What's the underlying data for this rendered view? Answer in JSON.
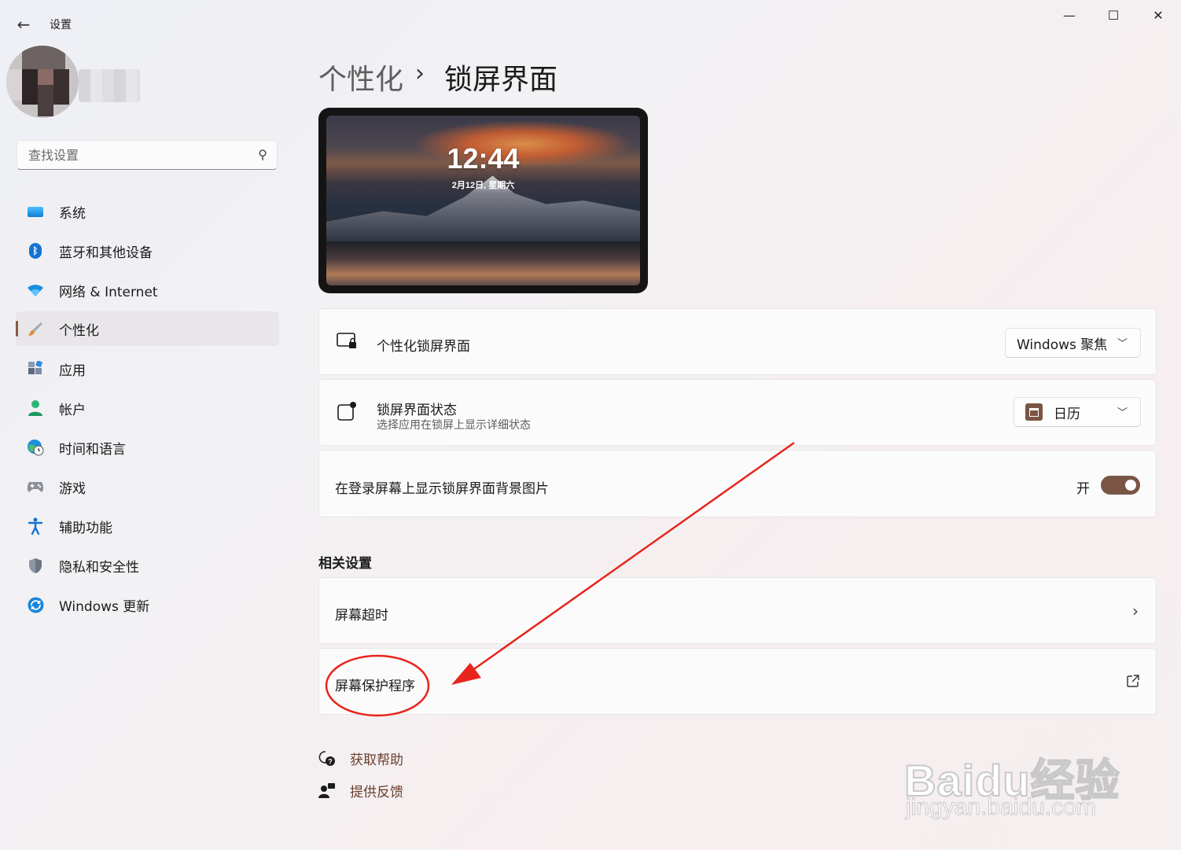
{
  "window": {
    "title": "设置",
    "controls": {
      "minimize": "—",
      "maximize": "☐",
      "close": "✕"
    }
  },
  "search": {
    "placeholder": "查找设置"
  },
  "sidebar": {
    "items": [
      {
        "label": "系统",
        "icon": "system-icon"
      },
      {
        "label": "蓝牙和其他设备",
        "icon": "bluetooth-icon"
      },
      {
        "label": "网络 & Internet",
        "icon": "wifi-icon"
      },
      {
        "label": "个性化",
        "icon": "brush-icon",
        "active": true
      },
      {
        "label": "应用",
        "icon": "apps-icon"
      },
      {
        "label": "帐户",
        "icon": "account-icon"
      },
      {
        "label": "时间和语言",
        "icon": "globe-clock-icon"
      },
      {
        "label": "游戏",
        "icon": "gamepad-icon"
      },
      {
        "label": "辅助功能",
        "icon": "accessibility-icon"
      },
      {
        "label": "隐私和安全性",
        "icon": "shield-icon"
      },
      {
        "label": "Windows 更新",
        "icon": "update-icon"
      }
    ]
  },
  "header": {
    "parent": "个性化",
    "separator": "›",
    "current": "锁屏界面"
  },
  "preview": {
    "time": "12:44",
    "date": "2月12日, 星期六"
  },
  "settings": {
    "personalize_lock": {
      "title": "个性化锁屏界面",
      "value": "Windows 聚焦"
    },
    "lock_status": {
      "title": "锁屏界面状态",
      "subtitle": "选择应用在锁屏上显示详细状态",
      "value": "日历"
    },
    "show_bg": {
      "title": "在登录屏幕上显示锁屏界面背景图片",
      "state": "开",
      "on": true
    }
  },
  "related": {
    "title": "相关设置",
    "items": [
      {
        "label": "屏幕超时",
        "trailing": "chevron-right-icon"
      },
      {
        "label": "屏幕保护程序",
        "trailing": "external-link-icon"
      }
    ]
  },
  "footer_links": [
    {
      "label": "获取帮助",
      "icon": "help-icon"
    },
    {
      "label": "提供反馈",
      "icon": "feedback-icon"
    }
  ],
  "watermark": {
    "logo": "Baidu经验",
    "url": "jingyan.baidu.com"
  },
  "colors": {
    "accent": "#7b5544",
    "annotation": "#e8241c"
  }
}
